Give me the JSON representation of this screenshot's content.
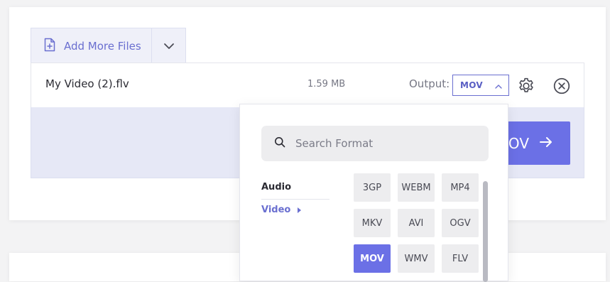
{
  "toolbar": {
    "add_files_label": "Add More Files"
  },
  "file": {
    "name": "My Video (2).flv",
    "size": "1.59 MB",
    "output_label": "Output:",
    "output_value": "MOV"
  },
  "convert": {
    "label": "OV"
  },
  "dropdown": {
    "search_placeholder": "Search Format",
    "categories": [
      {
        "label": "Audio"
      },
      {
        "label": "Video"
      }
    ],
    "formats": [
      {
        "label": "3GP"
      },
      {
        "label": "WEBM"
      },
      {
        "label": "MP4"
      },
      {
        "label": "MKV"
      },
      {
        "label": "AVI"
      },
      {
        "label": "OGV"
      },
      {
        "label": "MOV"
      },
      {
        "label": "WMV"
      },
      {
        "label": "FLV"
      }
    ],
    "selected_format": "MOV"
  },
  "colors": {
    "accent": "#6b70e6",
    "accent_text": "#6a6fd0",
    "band": "#e6e8f6"
  }
}
